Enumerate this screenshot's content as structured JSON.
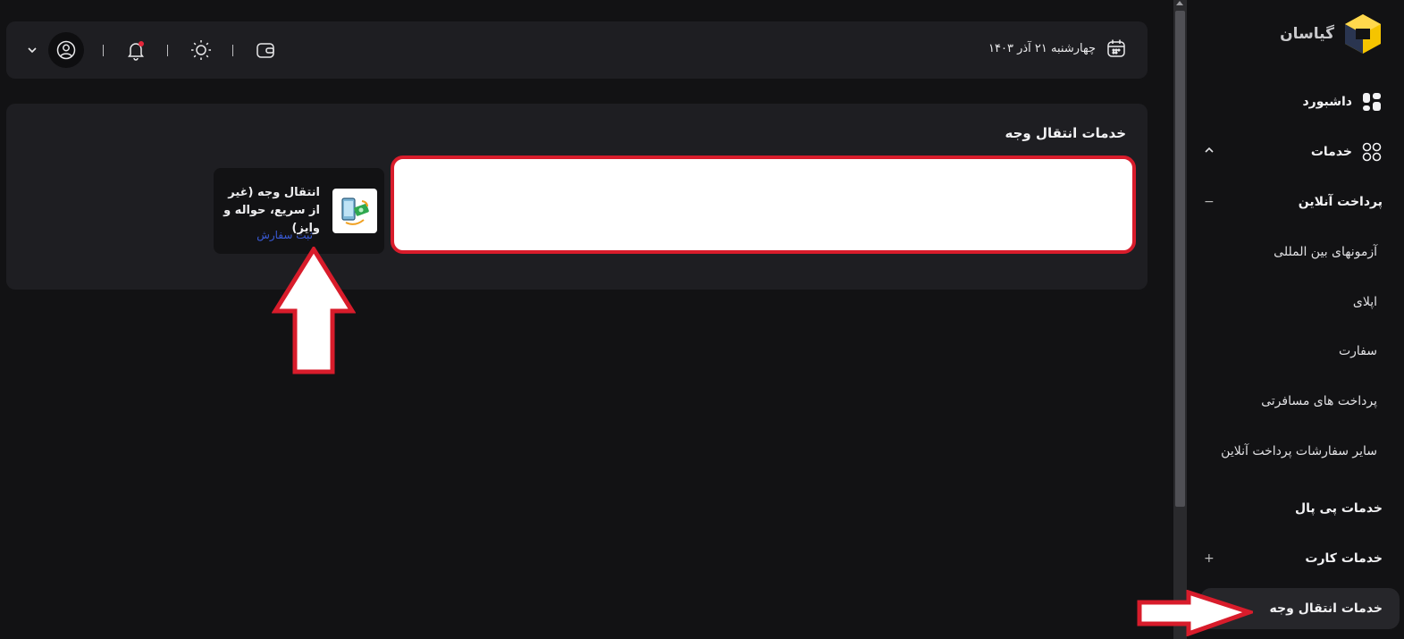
{
  "brand": {
    "name": "گیاسان"
  },
  "sidebar": {
    "dashboard": "داشبورد",
    "services": "خدمات",
    "online_payment": "پرداخت آنلاین",
    "online_payment_toggle": "−",
    "sub_items": [
      {
        "label": "آزمونهای بین المللی"
      },
      {
        "label": "اپلای"
      },
      {
        "label": "سفارت"
      },
      {
        "label": "پرداخت های مسافرتی"
      },
      {
        "label": "سایر سفارشات پرداخت آنلاین"
      }
    ],
    "paypal": "خدمات پی پال",
    "card_services": "خدمات کارت",
    "card_toggle": "+",
    "transfer_services": "خدمات انتقال وجه"
  },
  "header": {
    "date": "چهارشنبه ۲۱ آذر ۱۴۰۳",
    "icons": [
      "calendar-icon",
      "wallet-icon",
      "sun-icon",
      "bell-icon",
      "user-icon",
      "chevron-down-icon"
    ]
  },
  "panel": {
    "title": "خدمات انتقال وجه",
    "card": {
      "title": "انتقال وجه (غیر از سریع، حواله و وایز)",
      "link": "ثبت سفارش"
    }
  },
  "colors": {
    "accent_red": "#d81c2b",
    "link_blue": "#3a5bd8",
    "logo_yellow": "#f5c400",
    "logo_navy": "#2a3550",
    "notification_dot": "#e5263a"
  }
}
